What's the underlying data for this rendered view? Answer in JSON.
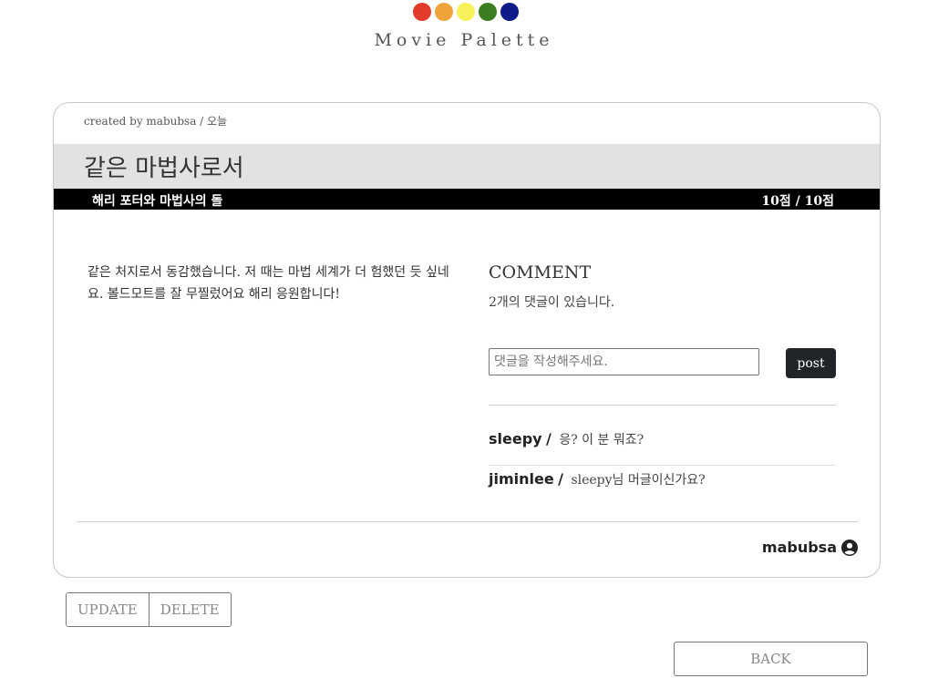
{
  "brand": {
    "name": "Movie Palette",
    "dots": [
      "#e33a2c",
      "#eea43a",
      "#f7f25a",
      "#3b7e22",
      "#0f1a8a"
    ]
  },
  "post": {
    "created_by": "created by mabubsa / 오늘",
    "title": "같은 마법사로서",
    "movie": "해리 포터와 마법사의 돌",
    "score": "10점 / 10점",
    "body": "같은 처지로서 동감했습니다. 저 때는 마법 세계가 더 험했던 듯 싶네요. 볼드모트를 잘 무찔렀어요 해리 응원합니다!",
    "author": "mabubsa"
  },
  "comments": {
    "heading": "COMMENT",
    "count_text": "2개의 댓글이 있습니다.",
    "input_placeholder": "댓글을 작성해주세요.",
    "post_label": "post",
    "items": [
      {
        "author": "sleepy",
        "text": "응?  이 분 뭐죠?"
      },
      {
        "author": "jiminlee",
        "text": "sleepy님 머글이신가요?"
      }
    ]
  },
  "actions": {
    "update_label": "UPDATE",
    "delete_label": "DELETE",
    "back_label": "BACK"
  },
  "icons": {
    "user": "user-circle-icon"
  }
}
